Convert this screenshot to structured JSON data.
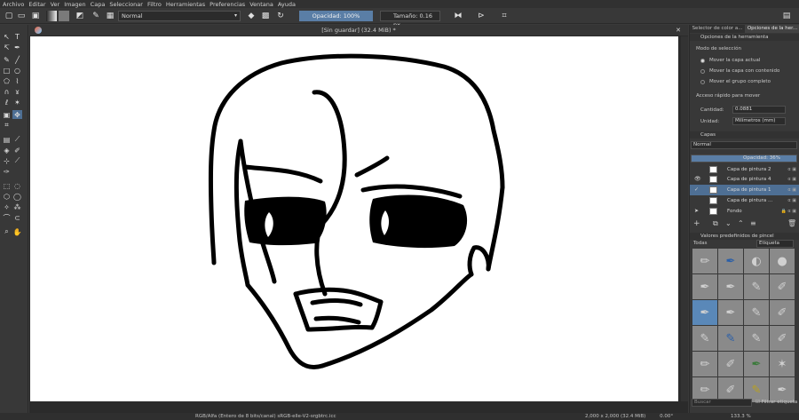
{
  "menu": [
    "Archivo",
    "Editar",
    "Ver",
    "Imagen",
    "Capa",
    "Seleccionar",
    "Filtro",
    "Herramientas",
    "Preferencias",
    "Ventana",
    "Ayuda"
  ],
  "toolbar": {
    "blend_mode": "Normal",
    "opacity": "Opacidad: 100%",
    "size": "Tamaño: 0.16 px"
  },
  "document": {
    "title": "[Sin guardar]  (32.4 MiB) *"
  },
  "statusbar": {
    "color_info": "RGB/Alfa (Entero de 8 bits/canal)  sRGB-elle-V2-srgbtrc.icc",
    "dims": "2,000 x 2,000 (32.4 MiB)",
    "angle": "0.00°",
    "zoom": "133.3 %"
  },
  "panel": {
    "tabs": [
      "Selector de color a...",
      "Opciones de la her..."
    ],
    "tool_options_title": "Opciones de la herramienta",
    "selection_mode_label": "Modo de selección",
    "options": [
      "Mover la capa actual",
      "Mover la capa con contenido",
      "Mover el grupo completo"
    ],
    "quick_move_label": "Acceso rápido para mover",
    "amount_label": "Cantidad:",
    "amount_value": "0.0881",
    "unit_label": "Unidad:",
    "unit_value": "Milímetros (mm)",
    "layers_title": "Capas",
    "layers_blend": "Normal",
    "layers_opacity": "Opacidad:  36%",
    "layers": [
      {
        "name": "Capa de pintura 2",
        "selected": false
      },
      {
        "name": "Capa de pintura 4",
        "selected": false
      },
      {
        "name": "Capa de pintura 1",
        "selected": true
      },
      {
        "name": "Capa de pintura ...",
        "selected": false
      },
      {
        "name": "Fondo",
        "selected": false
      }
    ],
    "presets_title": "Valores predefinidos de pincel",
    "presets_filter": "Todas",
    "presets_tag": "Etiqueta",
    "search_placeholder": "Buscar",
    "filter_tag_label": "Filtrar etiqueta"
  }
}
